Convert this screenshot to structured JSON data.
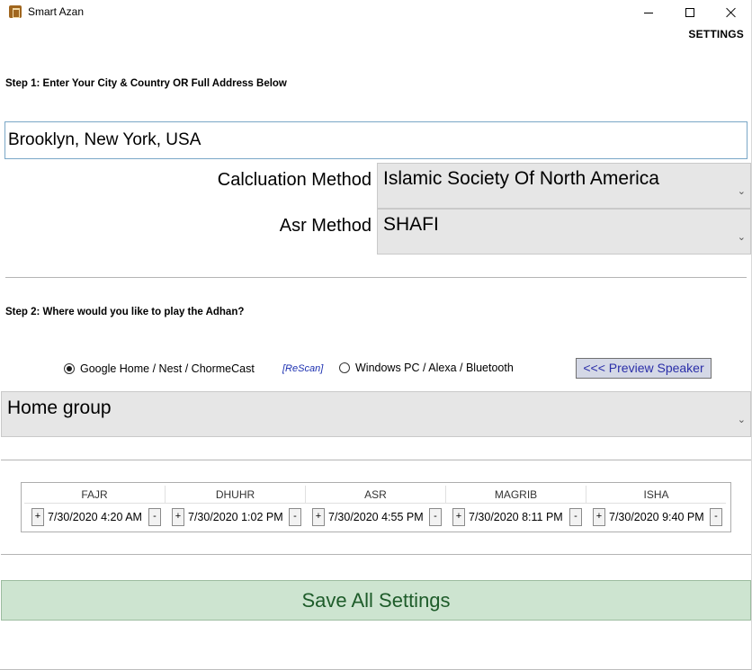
{
  "window": {
    "title": "Smart Azan",
    "controls": {
      "minimize": "minimize-icon",
      "maximize": "maximize-icon",
      "close": "close-icon"
    }
  },
  "header": {
    "settings_label": "SETTINGS"
  },
  "step1": {
    "label": "Step 1: Enter Your City & Country OR Full Address Below",
    "address_value": "Brooklyn, New York, USA",
    "calc_label": "Calcluation Method",
    "calc_value": "Islamic Society Of North America",
    "asr_label": "Asr Method",
    "asr_value": "SHAFI"
  },
  "step2": {
    "label": "Step 2: Where would you like to play the Adhan?",
    "option_google": "Google Home / Nest / ChormeCast",
    "option_google_selected": true,
    "rescan_label": "[ReScan]",
    "option_windows": "Windows PC / Alexa / Bluetooth",
    "preview_label": "<<< Preview Speaker",
    "speaker_value": "Home group"
  },
  "prayer_times": [
    {
      "name": "FAJR",
      "time": "7/30/2020 4:20 AM"
    },
    {
      "name": "DHUHR",
      "time": "7/30/2020 1:02 PM"
    },
    {
      "name": "ASR",
      "time": "7/30/2020 4:55 PM"
    },
    {
      "name": "MAGRIB",
      "time": "7/30/2020 8:11 PM"
    },
    {
      "name": "ISHA",
      "time": "7/30/2020 9:40 PM"
    }
  ],
  "stepper": {
    "plus": "+",
    "minus": "-"
  },
  "save_label": "Save All Settings",
  "colors": {
    "save_bg": "#cde4d0",
    "save_text": "#1e5c2a",
    "preview_bg": "#d4d8e6",
    "rescan": "#1b2fb0"
  }
}
